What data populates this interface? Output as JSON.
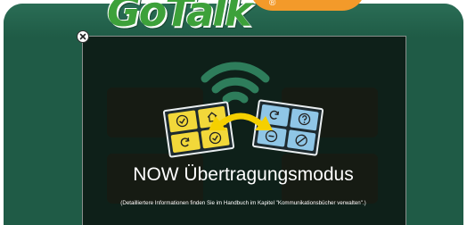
{
  "app": {
    "logo_text": "GoTalk",
    "logo_reg_mark": "®"
  },
  "modal": {
    "title": "NOW Übertragungsmodus",
    "note": "(Detailliertere Informationen finden Sie im Handbuch im Kapitel \"Kommunikationsbücher verwalten\".)",
    "close_icon": "close-icon",
    "illustration": {
      "wifi_icon": "wifi-icon",
      "transfer_icon": "double-arrow-icon",
      "left_tablet_cells": [
        "check",
        "home",
        "refresh",
        "check"
      ],
      "right_tablet_cells": [
        "refresh",
        "question",
        "minus",
        "slash"
      ]
    }
  },
  "colors": {
    "frame_green": "#1f5b46",
    "logo_green": "#3da13a",
    "logo_orange": "#f39a2a",
    "wifi_green": "#2e7d5b",
    "arrow_yellow": "#f5d000",
    "tile_yellow": "#f2d83a",
    "tile_blue": "#8fc6e6"
  }
}
